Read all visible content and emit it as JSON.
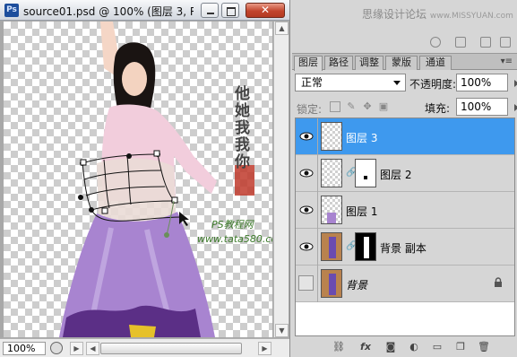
{
  "document": {
    "app_badge": "Ps",
    "title": "source01.psd @ 100% (图层 3, R...",
    "zoom": "100%",
    "watermark_vertical": "他她我我你",
    "watermark_line1": "PS教程网",
    "watermark_line2": "www.tata580.com"
  },
  "window_buttons": {
    "minimize_icon": "minimize-icon",
    "maximize_icon": "maximize-icon",
    "close_label": "✕"
  },
  "site_watermark": {
    "text": "思缘设计论坛",
    "url": "www.MISSYUAN.com"
  },
  "layers_panel": {
    "tabs": [
      {
        "label": "图层",
        "active": true
      },
      {
        "label": "路径",
        "active": false
      },
      {
        "label": "调整",
        "active": false
      },
      {
        "label": "蒙版",
        "active": false
      },
      {
        "label": "通道",
        "active": false
      }
    ],
    "blend_mode": "正常",
    "opacity_label": "不透明度:",
    "opacity_value": "100%",
    "lock_label": "锁定:",
    "fill_label": "填充:",
    "fill_value": "100%",
    "layers": [
      {
        "name": "图层 3",
        "visible": true,
        "selected": true
      },
      {
        "name": "图层 2",
        "visible": true,
        "selected": false,
        "has_mask": true
      },
      {
        "name": "图层 1",
        "visible": true,
        "selected": false
      },
      {
        "name": "背景 副本",
        "visible": true,
        "selected": false,
        "has_mask": true
      },
      {
        "name": "背景",
        "visible": false,
        "selected": false,
        "locked": true
      }
    ],
    "bottom_icons": [
      "link-layers-icon",
      "fx-icon",
      "add-mask-icon",
      "adjustment-layer-icon",
      "new-group-icon",
      "new-layer-icon",
      "delete-layer-icon"
    ],
    "fx_label": "fx"
  },
  "colors": {
    "selection": "#3e99ee",
    "skirt": "#a884d0",
    "blouse": "#f2cddc",
    "seal_red": "#c0392b"
  }
}
